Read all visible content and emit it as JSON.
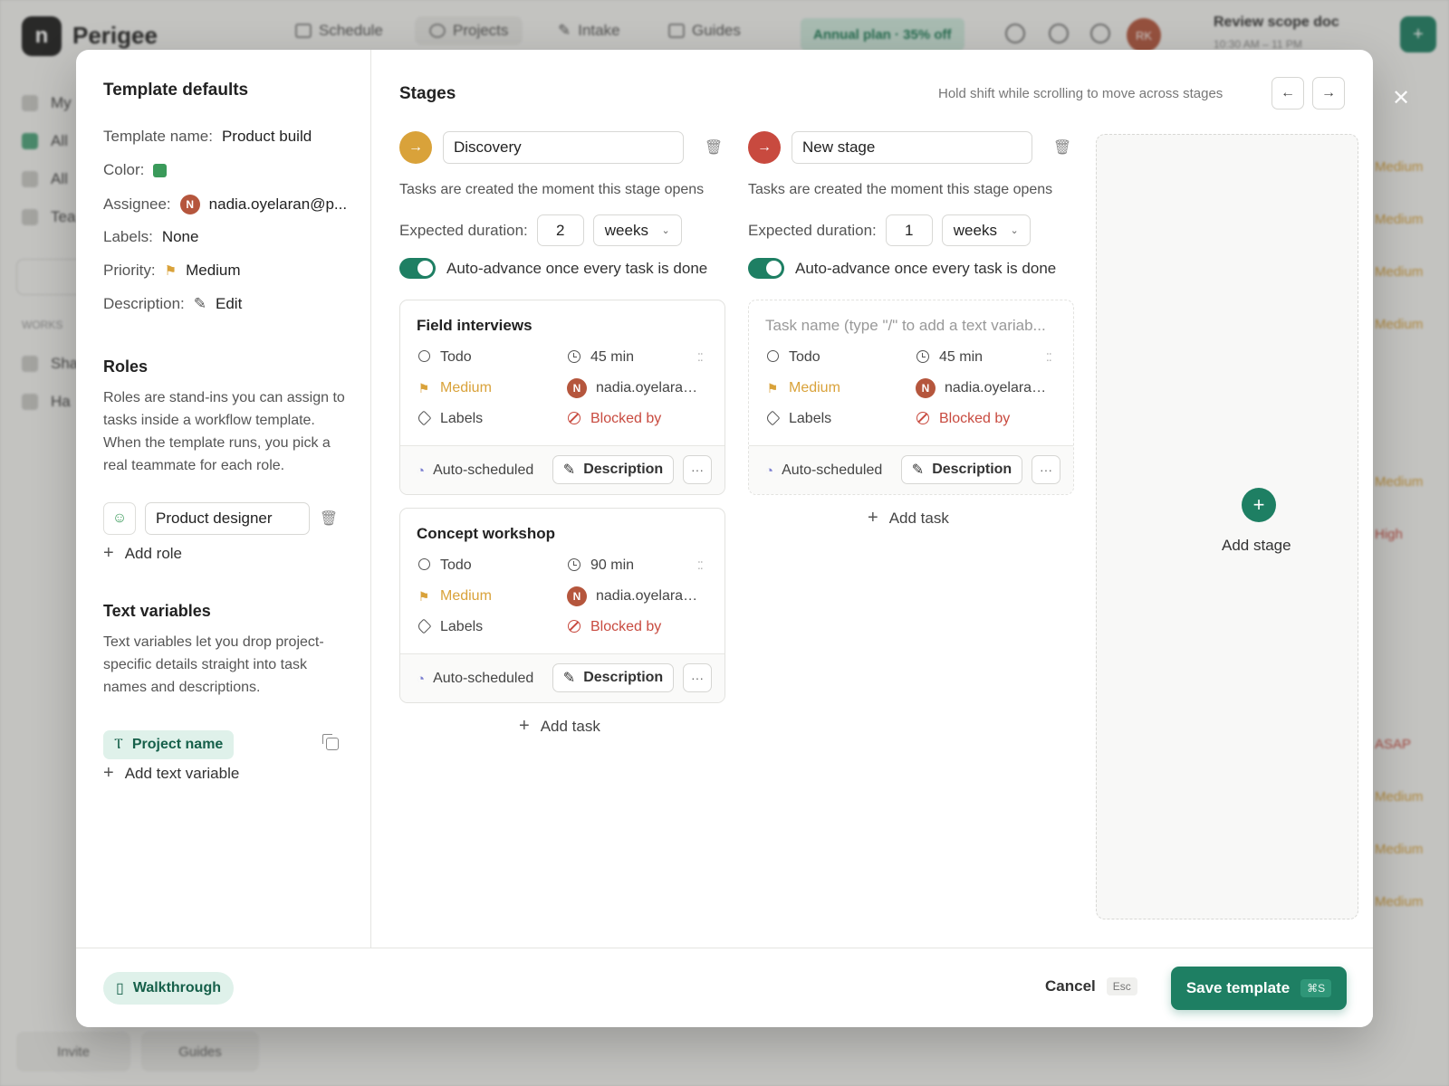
{
  "background": {
    "brand": "Perigee",
    "nav": [
      "Schedule",
      "Projects",
      "Intake",
      "Guides"
    ],
    "promo": "Annual plan · 35% off",
    "avatar_initials": "RK",
    "review_title": "Review scope doc",
    "review_time": "10:30 AM – 11 PM",
    "sidebar": [
      "My",
      "All",
      "All",
      "Tea"
    ],
    "sidebar_section": "WORKS",
    "sidebar_sub": [
      "Sha",
      "Ha"
    ],
    "bottom_buttons": [
      "Invite",
      "Guides"
    ],
    "priorities": [
      "Medium",
      "Medium",
      "Medium",
      "Medium",
      "Medium",
      "High",
      "ASAP",
      "Medium",
      "Medium",
      "Medium"
    ]
  },
  "modal": {
    "title": "Template defaults",
    "template_name_label": "Template name:",
    "template_name": "Product build",
    "color_label": "Color:",
    "color": "#3a9a5a",
    "assignee_label": "Assignee:",
    "assignee_initial": "N",
    "assignee": "nadia.oyelaran@p...",
    "labels_label": "Labels:",
    "labels": "None",
    "priority_label": "Priority:",
    "priority": "Medium",
    "description_label": "Description:",
    "description_action": "Edit",
    "roles_title": "Roles",
    "roles_desc": "Roles are stand-ins you can assign to tasks inside a workflow template. When the template runs, you pick a real teammate for each role.",
    "role_name": "Product designer",
    "add_role": "Add role",
    "vars_title": "Text variables",
    "vars_desc": "Text variables let you drop project-specific details straight into task names and descriptions.",
    "var_chip": "Project name",
    "add_var": "Add text variable"
  },
  "stages_panel": {
    "title": "Stages",
    "hint": "Hold shift while scrolling to move across stages",
    "add_stage": "Add stage",
    "stages": [
      {
        "name": "Discovery",
        "color": "#d9a23a",
        "note": "Tasks are created the moment this stage opens",
        "duration_label": "Expected duration:",
        "duration": "2",
        "unit": "weeks",
        "auto_advance": "Auto-advance once every task is done",
        "add_task": "Add task",
        "tasks": [
          {
            "title": "Field interviews",
            "status": "Todo",
            "duration": "45 min",
            "priority": "Medium",
            "assignee": "nadia.oyelaran...",
            "labels": "Labels",
            "blocked": "Blocked by",
            "schedule": "Auto-scheduled",
            "desc_btn": "Description",
            "more": "···"
          },
          {
            "title": "Concept workshop",
            "status": "Todo",
            "duration": "90 min",
            "priority": "Medium",
            "assignee": "nadia.oyelaran...",
            "labels": "Labels",
            "blocked": "Blocked by",
            "schedule": "Auto-scheduled",
            "desc_btn": "Description",
            "more": "···"
          }
        ]
      },
      {
        "name": "New stage",
        "color": "#c84a3f",
        "note": "Tasks are created the moment this stage opens",
        "duration_label": "Expected duration:",
        "duration": "1",
        "unit": "weeks",
        "auto_advance": "Auto-advance once every task is done",
        "add_task": "Add task",
        "tasks": [
          {
            "title_placeholder": "Task name (type \"/\" to add a text variab...",
            "status": "Todo",
            "duration": "45 min",
            "priority": "Medium",
            "assignee": "nadia.oyelaran...",
            "labels": "Labels",
            "blocked": "Blocked by",
            "schedule": "Auto-scheduled",
            "desc_btn": "Description",
            "more": "···"
          }
        ]
      }
    ]
  },
  "footer": {
    "walkthrough": "Walkthrough",
    "cancel": "Cancel",
    "cancel_key": "Esc",
    "save": "Save template",
    "save_key": "⌘S"
  },
  "colors": {
    "accent": "#1e7f63",
    "medium": "#d9a23a",
    "danger": "#c84a3f"
  }
}
